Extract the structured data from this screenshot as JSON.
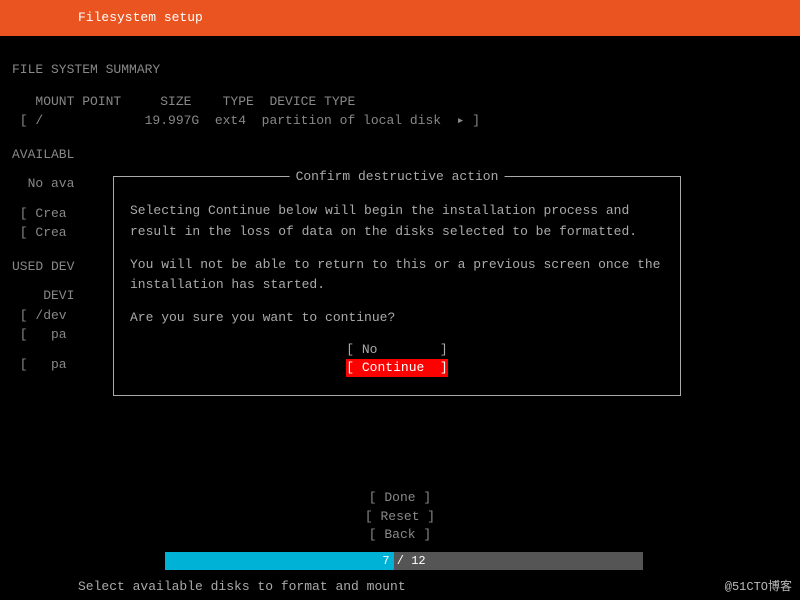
{
  "header": {
    "title": "Filesystem setup"
  },
  "summary": {
    "heading": "FILE SYSTEM SUMMARY",
    "columns": "   MOUNT POINT     SIZE    TYPE  DEVICE TYPE",
    "row": " [ /             19.997G  ext4  partition of local disk  ▸ ]"
  },
  "available": {
    "heading": "AVAILABL",
    "line1": "  No ava",
    "line2": " [ Crea",
    "line3": " [ Crea"
  },
  "used": {
    "heading": "USED DEV",
    "line1": "    DEVI",
    "line2": " [ /dev",
    "line3": " [   pa",
    "line4": " [   pa"
  },
  "dialog": {
    "title": " Confirm destructive action ",
    "p1": "Selecting Continue below will begin the installation process and result in the loss of data on the disks selected to be formatted.",
    "p2": "You will not be able to return to this or a previous screen once the installation has started.",
    "p3": "Are you sure you want to continue?",
    "no_label": "[ No        ]",
    "continue_label": "[ Continue  ]"
  },
  "bottom_buttons": {
    "done": "[ Done       ]",
    "reset": "[ Reset      ]",
    "back": "[ Back       ]"
  },
  "progress": {
    "text": "7 / 12",
    "percent": 48
  },
  "helper": "Select available disks to format and mount",
  "watermark": "@51CTO博客"
}
